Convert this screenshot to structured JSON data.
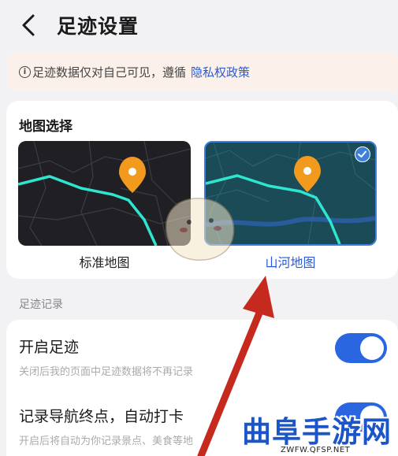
{
  "header": {
    "title": "足迹设置"
  },
  "notice": {
    "text": "足迹数据仅对自己可见，遵循",
    "link": "隐私权政策"
  },
  "map_section": {
    "title": "地图选择",
    "options": [
      {
        "label": "标准地图",
        "selected": false
      },
      {
        "label": "山河地图",
        "selected": true
      }
    ]
  },
  "records": {
    "title": "足迹记录",
    "items": [
      {
        "label": "开启足迹",
        "description": "关闭后我的页面中足迹数据将不再记录",
        "enabled": true
      },
      {
        "label": "记录导航终点，自动打卡",
        "description": "开启后将自动为你记录景点、美食等地",
        "enabled": true
      }
    ]
  },
  "watermark": {
    "text": "曲阜手游网",
    "url": "ZWFW.QFSP.NET"
  },
  "colors": {
    "accent": "#2a66e0",
    "link": "#2a5bd7",
    "notice_bg": "#fbf0ea",
    "arrow": "#c62a1e",
    "pin": "#f29a1e"
  }
}
